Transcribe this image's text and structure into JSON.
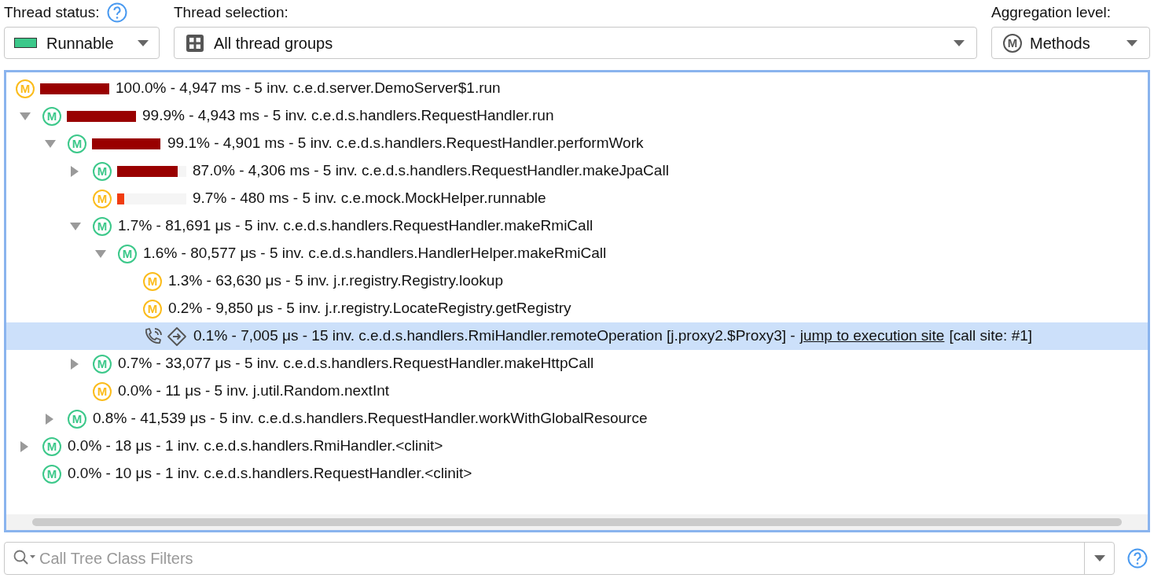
{
  "thread_status": {
    "label": "Thread status:",
    "value": "Runnable",
    "color": "#3cc88a"
  },
  "thread_selection": {
    "label": "Thread selection:",
    "value": "All thread groups"
  },
  "aggregation": {
    "label": "Aggregation level:",
    "icon_letter": "M",
    "value": "Methods"
  },
  "tree": [
    {
      "kind": "method",
      "badge": "M",
      "color": "#fbbc1c",
      "expandable": false,
      "selected": false,
      "level": 1.0,
      "text": "100.0% - 4,947 ms - 5 inv. c.e.d.server.DemoServer$1.run",
      "children": [
        {
          "kind": "method",
          "badge": "M",
          "color": "#3cc88a",
          "expandable": true,
          "expanded": true,
          "selected": false,
          "level": 0.999,
          "text": "99.9% - 4,943 ms - 5 inv. c.e.d.s.handlers.RequestHandler.run",
          "children": [
            {
              "kind": "method",
              "badge": "M",
              "color": "#3cc88a",
              "expandable": true,
              "expanded": true,
              "selected": false,
              "level": 0.991,
              "text": "99.1% - 4,901 ms - 5 inv. c.e.d.s.handlers.RequestHandler.performWork",
              "children": [
                {
                  "kind": "method",
                  "badge": "M",
                  "color": "#3cc88a",
                  "expandable": true,
                  "expanded": false,
                  "selected": false,
                  "level": 0.87,
                  "text": "87.0% - 4,306 ms - 5 inv. c.e.d.s.handlers.RequestHandler.makeJpaCall"
                },
                {
                  "kind": "method",
                  "badge": "M",
                  "color": "#fbbc1c",
                  "expandable": false,
                  "selected": false,
                  "level": 0.097,
                  "text": "9.7% - 480 ms - 5 inv. c.e.mock.MockHelper.runnable"
                },
                {
                  "kind": "method",
                  "badge": "M",
                  "color": "#3cc88a",
                  "expandable": true,
                  "expanded": true,
                  "selected": false,
                  "text": "1.7% - 81,691 μs - 5 inv. c.e.d.s.handlers.RequestHandler.makeRmiCall",
                  "children": [
                    {
                      "kind": "method",
                      "badge": "M",
                      "color": "#3cc88a",
                      "expandable": true,
                      "expanded": true,
                      "selected": false,
                      "text": "1.6% - 80,577 μs - 5 inv. c.e.d.s.handlers.HandlerHelper.makeRmiCall",
                      "children": [
                        {
                          "kind": "method",
                          "badge": "M",
                          "color": "#fbbc1c",
                          "expandable": false,
                          "selected": false,
                          "text": "1.3% - 63,630 μs - 5 inv. j.r.registry.Registry.lookup"
                        },
                        {
                          "kind": "method",
                          "badge": "M",
                          "color": "#fbbc1c",
                          "expandable": false,
                          "selected": false,
                          "text": "0.2% - 9,850 μs - 5 inv. j.r.registry.LocateRegistry.getRegistry"
                        },
                        {
                          "kind": "call_site",
                          "expandable": false,
                          "selected": true,
                          "text": "0.1% - 7,005 μs - 15 inv. c.e.d.s.handlers.RmiHandler.remoteOperation [j.proxy2.$Proxy3] -",
                          "link": "jump to execution site",
                          "suffix": "[call site: #1]"
                        }
                      ]
                    }
                  ]
                },
                {
                  "kind": "method",
                  "badge": "M",
                  "color": "#3cc88a",
                  "expandable": true,
                  "expanded": false,
                  "selected": false,
                  "text": "0.7% - 33,077 μs - 5 inv. c.e.d.s.handlers.RequestHandler.makeHttpCall"
                },
                {
                  "kind": "method",
                  "badge": "M",
                  "color": "#fbbc1c",
                  "expandable": false,
                  "selected": false,
                  "text": "0.0% - 11 μs - 5 inv. j.util.Random.nextInt"
                }
              ]
            },
            {
              "kind": "method",
              "badge": "M",
              "color": "#3cc88a",
              "expandable": true,
              "expanded": false,
              "selected": false,
              "text": "0.8% - 41,539 μs - 5 inv. c.e.d.s.handlers.RequestHandler.workWithGlobalResource"
            }
          ]
        },
        {
          "kind": "method",
          "badge": "M",
          "color": "#3cc88a",
          "expandable": true,
          "expanded": false,
          "selected": false,
          "text": "0.0% - 18 μs - 1 inv. c.e.d.s.handlers.RmiHandler.<clinit>"
        },
        {
          "kind": "method",
          "badge": "M",
          "color": "#3cc88a",
          "expandable": false,
          "selected": false,
          "text": "0.0% - 10 μs - 1 inv. c.e.d.s.handlers.RequestHandler.<clinit>"
        }
      ]
    }
  ],
  "filter": {
    "placeholder": "Call Tree Class Filters"
  }
}
